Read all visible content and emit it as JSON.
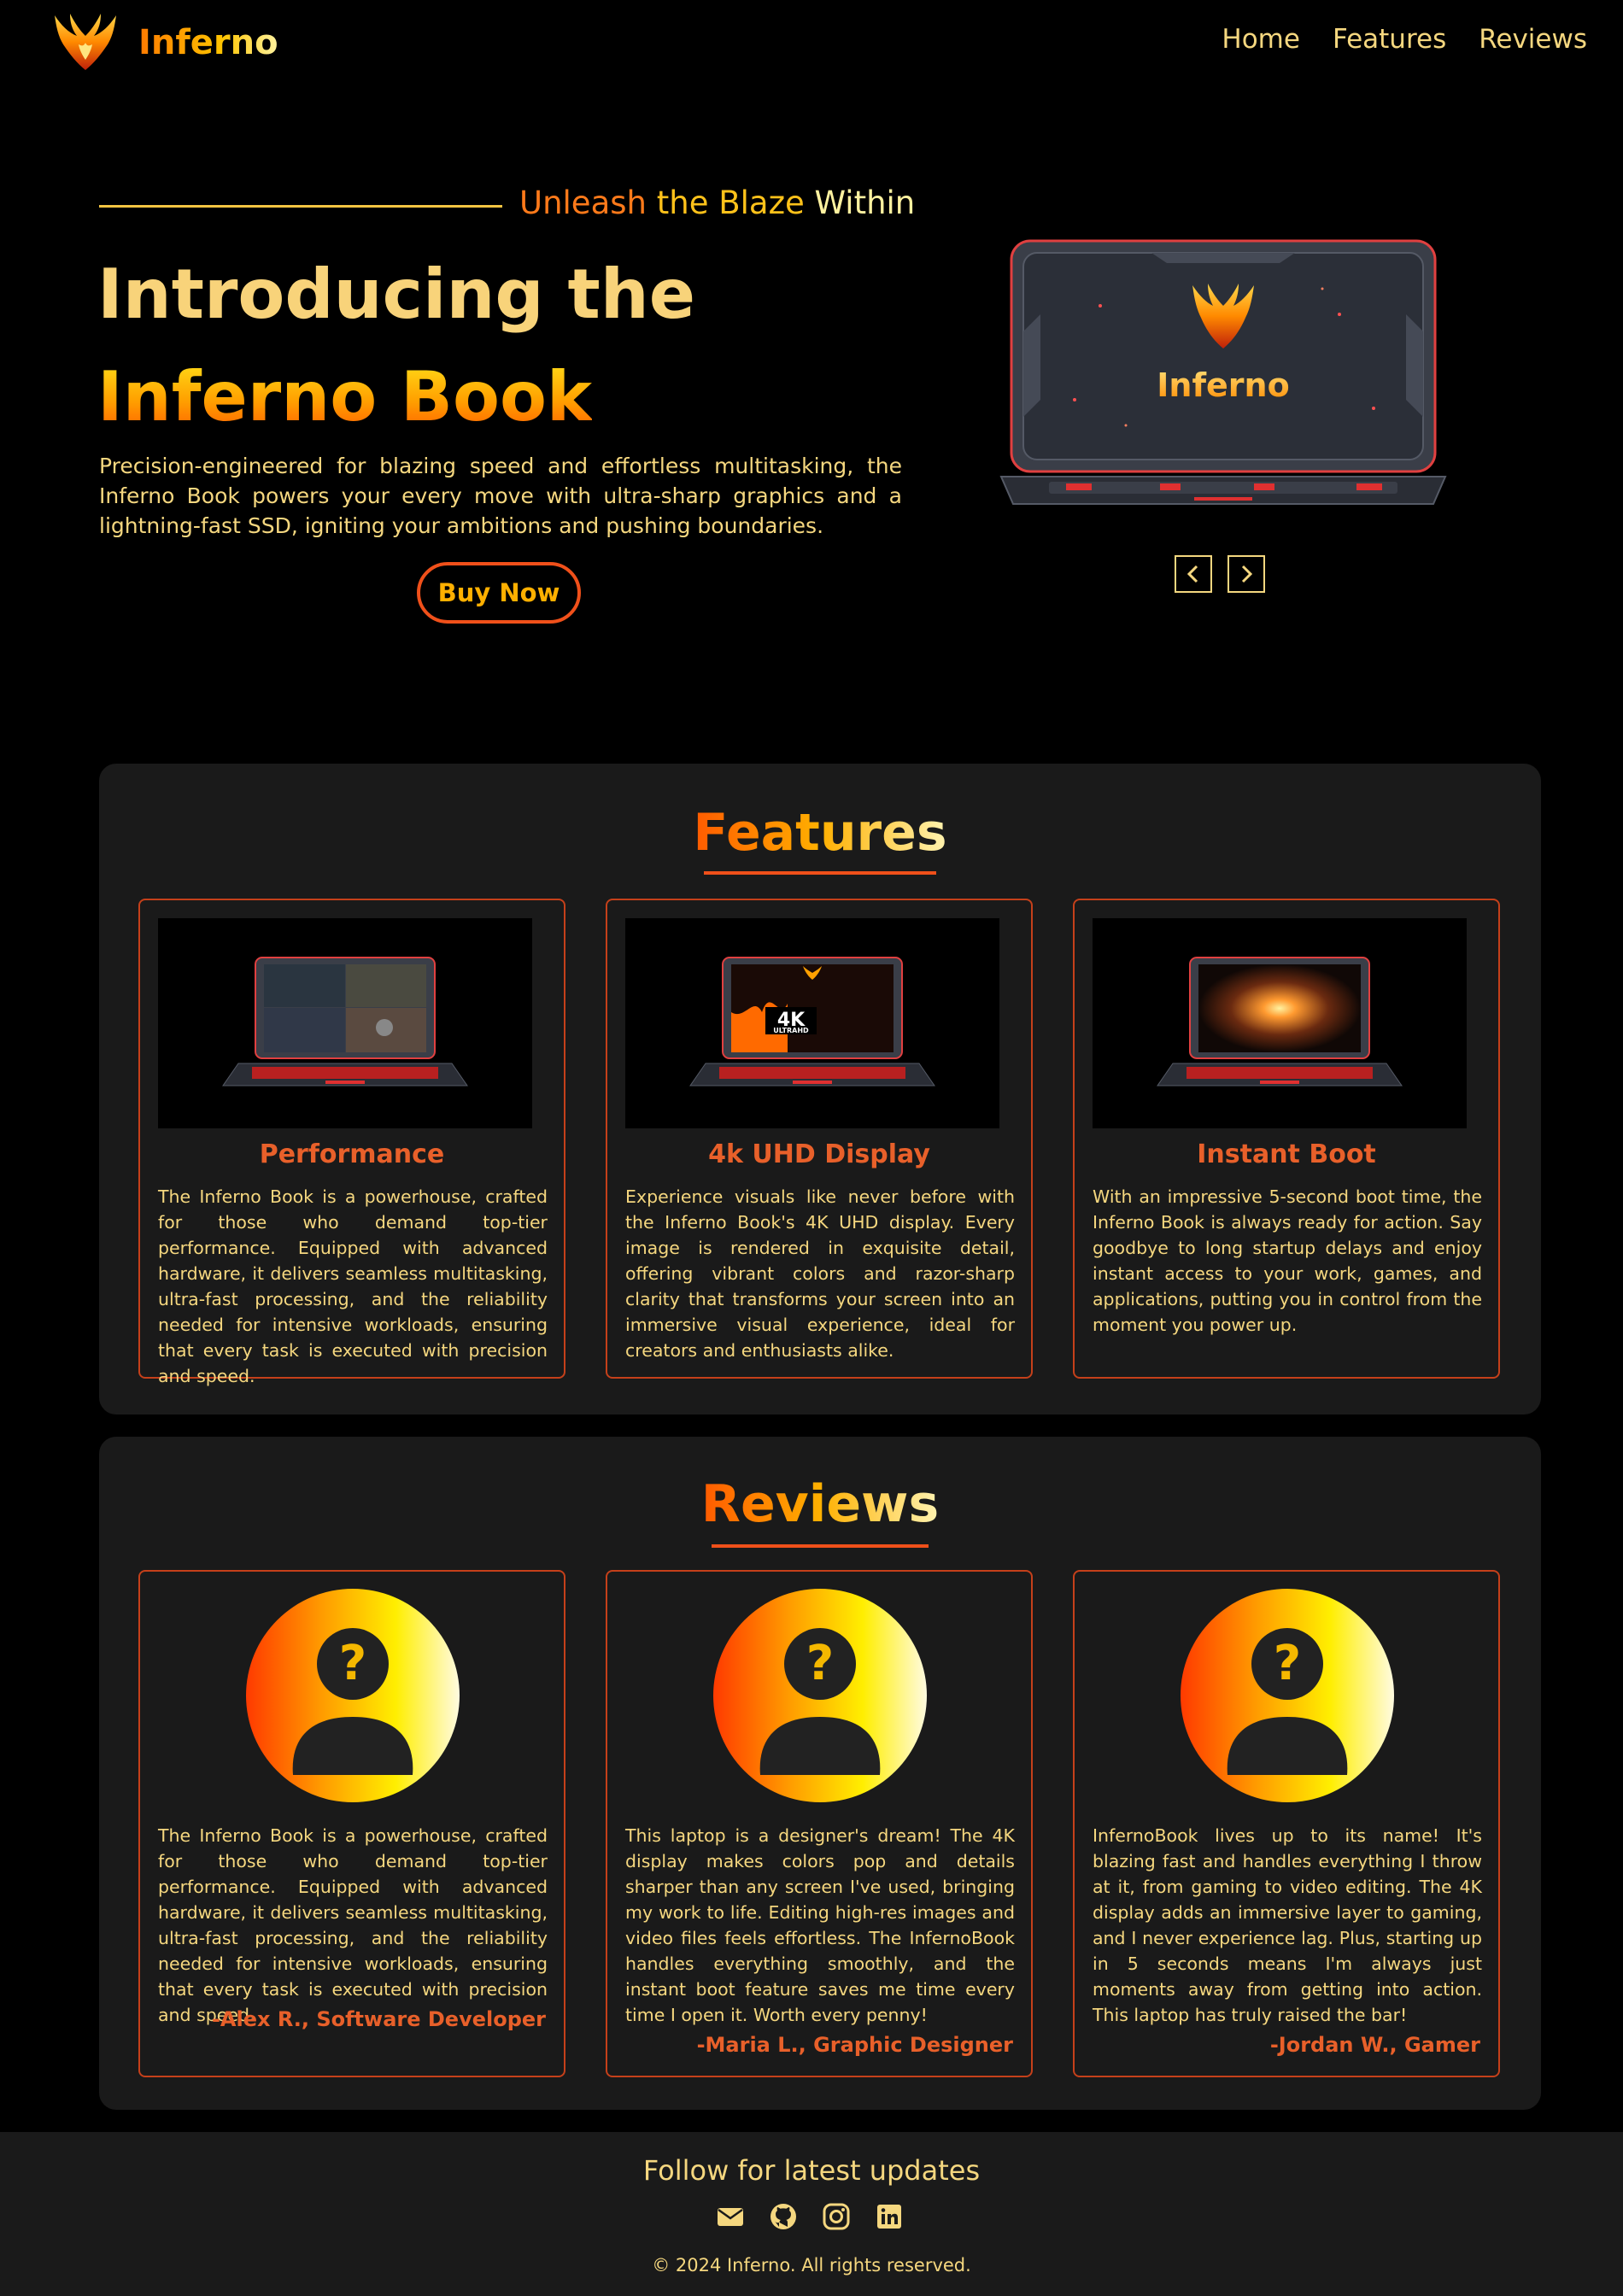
{
  "brand": {
    "name": "Inferno"
  },
  "nav": {
    "links": [
      "Home",
      "Features",
      "Reviews"
    ]
  },
  "hero": {
    "tagline": {
      "part1": "Unleash",
      "part2": " the Blaze ",
      "part3": "Within"
    },
    "heading_line1": "Introducing the",
    "heading_line2": "Inferno Book",
    "description": "Precision-engineered for blazing speed and effortless multitasking, the Inferno Book powers your every move with ultra-sharp graphics and a lightning-fast SSD, igniting your ambitions and pushing boundaries.",
    "buy_label": "Buy Now",
    "laptop_logo_text": "Inferno"
  },
  "features": {
    "title": "Features",
    "cards": [
      {
        "title": "Performance",
        "text": "The Inferno Book is a powerhouse, crafted for those who demand top-tier performance. Equipped with advanced hardware, it delivers seamless multitasking, ultra-fast processing, and the reliability needed for intensive workloads, ensuring that every task is executed with precision and speed."
      },
      {
        "title": "4k UHD Display",
        "text": "Experience visuals like never before with the Inferno Book's 4K UHD display. Every image is rendered in exquisite detail, offering vibrant colors and razor-sharp clarity that transforms your screen into an immersive visual experience, ideal for creators and enthusiasts alike.",
        "badge_main": "4K",
        "badge_sub": "ULTRAHD"
      },
      {
        "title": "Instant Boot",
        "text": "With an impressive 5-second boot time, the Inferno Book is always ready for action. Say goodbye to long startup delays and enjoy instant access to your work, games, and applications, putting you in control from the moment you power up."
      }
    ]
  },
  "reviews": {
    "title": "Reviews",
    "cards": [
      {
        "text": "The Inferno Book is a powerhouse, crafted for those who demand top-tier performance. Equipped with advanced hardware, it delivers seamless multitasking, ultra-fast processing, and the reliability needed for intensive workloads, ensuring that every task is executed with precision and speed.",
        "author": "-Alex R., Software Developer"
      },
      {
        "text": "This laptop is a designer's dream! The 4K display makes colors pop and details sharper than any screen I've used, bringing my work to life. Editing high-res images and video files feels effortless. The InfernoBook handles everything smoothly, and the instant boot feature saves me time every time I open it. Worth every penny!",
        "author": "-Maria L., Graphic Designer"
      },
      {
        "text": "InfernoBook lives up to its name! It's blazing fast and handles everything I throw at it, from gaming to video editing. The 4K display adds an immersive layer to gaming, and I never experience lag. Plus, starting up in 5 seconds means I'm always just moments away from getting into action. This laptop has truly raised the bar!",
        "author": "-Jordan W., Gamer"
      }
    ]
  },
  "footer": {
    "follow": "Follow for latest updates",
    "socials": [
      "mail-icon",
      "github-icon",
      "instagram-icon",
      "linkedin-icon"
    ],
    "copyright": "© 2024 Inferno. All rights reserved."
  },
  "colors": {
    "background": "#000000",
    "panel": "#1a1a1a",
    "accent": "#e8602a",
    "text": "#f5d77f",
    "border": "#c5401a"
  }
}
